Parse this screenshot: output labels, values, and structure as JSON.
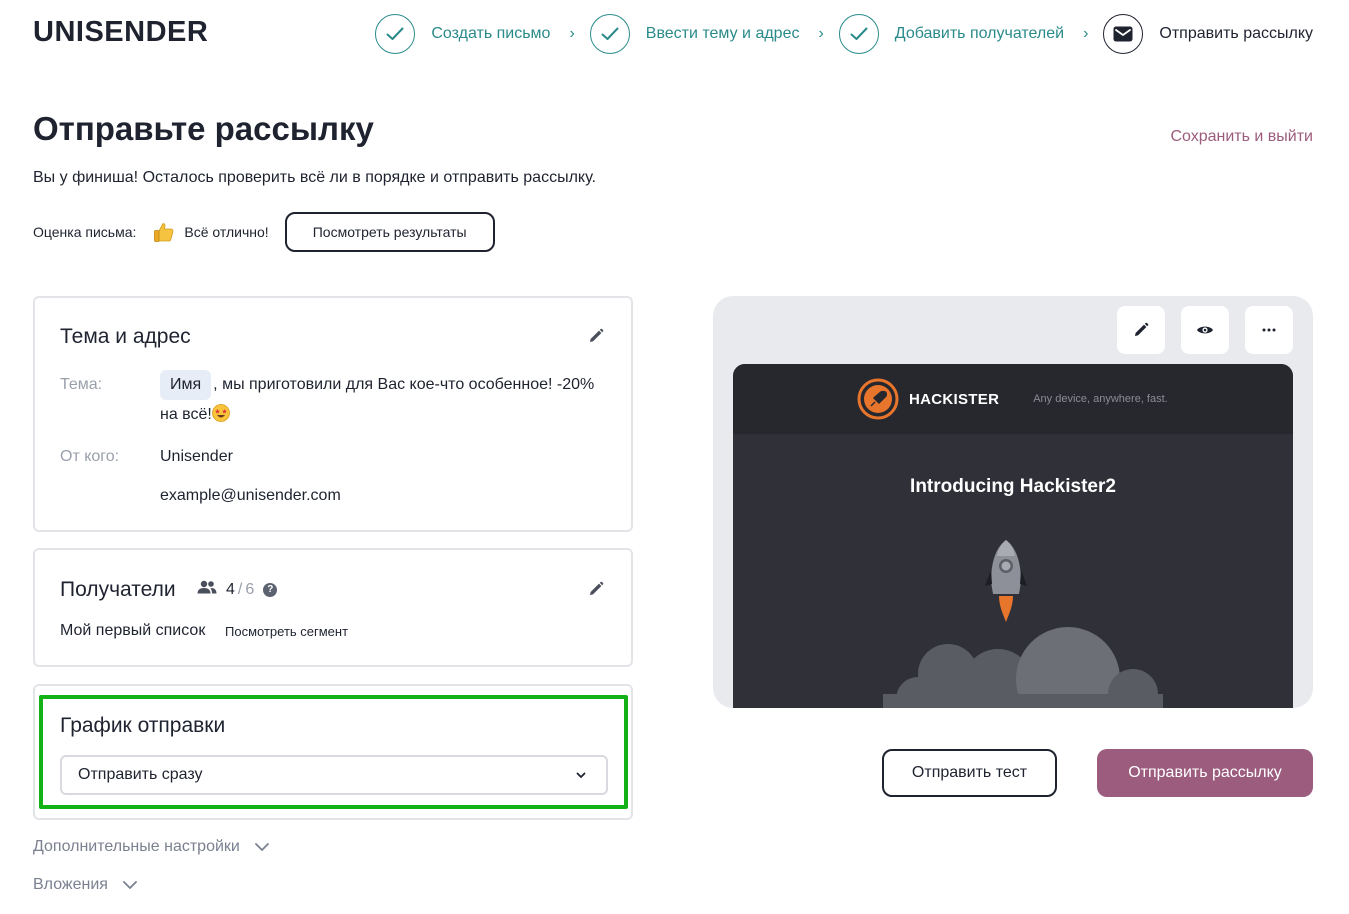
{
  "logo": "UNISENDER",
  "steps": [
    {
      "label": "Создать письмо",
      "state": "done"
    },
    {
      "label": "Ввести тему и адрес",
      "state": "done"
    },
    {
      "label": "Добавить получателей",
      "state": "done"
    },
    {
      "label": "Отправить рассылку",
      "state": "active"
    }
  ],
  "step_separator": "›",
  "page_title": "Отправьте рассылку",
  "save_exit": "Сохранить и выйти",
  "subtitle": "Вы у финиша! Осталось проверить всё ли в порядке и отправить рассылку.",
  "rating": {
    "label": "Оценка письма:",
    "icon": "thumbs-up-icon",
    "value": "Всё отлично!",
    "button": "Посмотреть результаты"
  },
  "subject_card": {
    "title": "Тема и адрес",
    "subject_label": "Тема:",
    "subject_chip": "Имя",
    "subject_text": ", мы приготовили для Вас кое-что особенное! -20% на всё!",
    "subject_emoji": "star-struck-emoji",
    "from_label": "От кого:",
    "from_name": "Unisender",
    "from_email": "example@unisender.com"
  },
  "recipients_card": {
    "title": "Получатели",
    "count": "4",
    "separator": "/",
    "total": "6",
    "help": "?",
    "list_name": "Мой первый список",
    "segment_link": "Посмотреть сегмент"
  },
  "schedule_card": {
    "title": "График отправки",
    "selected": "Отправить сразу"
  },
  "extra_settings": "Дополнительные настройки",
  "attachments": "Вложения",
  "preview": {
    "brand": "HACKISTER",
    "tagline": "Any device, anywhere, fast.",
    "heading": "Introducing Hackister2"
  },
  "buttons": {
    "send_test": "Отправить тест",
    "send_campaign": "Отправить рассылку"
  },
  "colors": {
    "accent": "#9b5c7e",
    "step_done": "#2a8a8a",
    "text": "#1f2330",
    "highlight": "#12b216"
  }
}
